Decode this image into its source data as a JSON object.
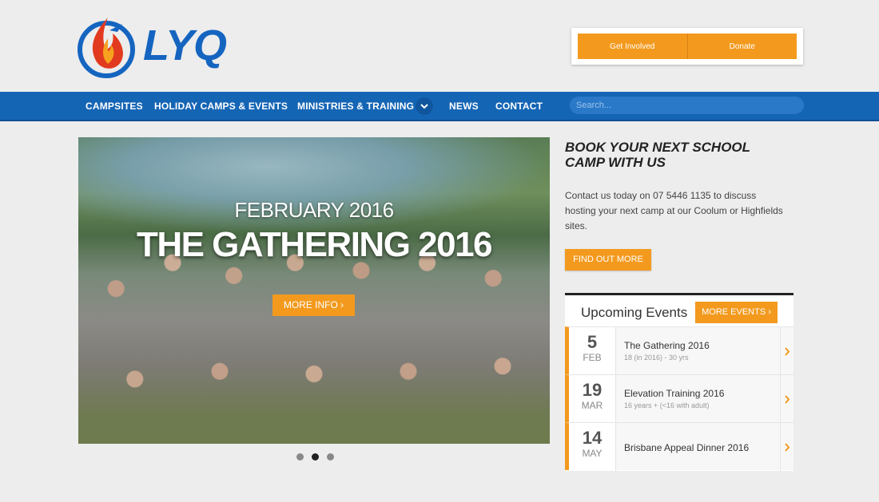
{
  "brand": {
    "name": "LYQ",
    "accent": "#f39a1e",
    "nav_bg": "#1565b5"
  },
  "header": {
    "cta": [
      "Get Involved",
      "Donate"
    ]
  },
  "nav": {
    "items": [
      "CAMPSITES",
      "HOLIDAY CAMPS & EVENTS",
      "MINISTRIES & TRAINING",
      "NEWS",
      "CONTACT"
    ],
    "search_placeholder": "Search..."
  },
  "hero": {
    "date": "FEBRUARY 2016",
    "title": "THE GATHERING 2016",
    "button": "MORE INFO",
    "slides": 3,
    "active_slide": 2
  },
  "sidebar": {
    "book_title": "BOOK YOUR NEXT SCHOOL CAMP WITH US",
    "book_body": "Contact us today on 07 5446 1135 to discuss hosting your next camp at our Coolum or Highfields sites.",
    "find_button": "FIND OUT MORE",
    "events_title": "Upcoming Events",
    "more_events": "MORE EVENTS",
    "events": [
      {
        "day": "5",
        "month": "FEB",
        "name": "The Gathering 2016",
        "sub": "18 (in 2016) - 30 yrs"
      },
      {
        "day": "19",
        "month": "MAR",
        "name": "Elevation Training 2016",
        "sub": "16 years + (<16 with adult)"
      },
      {
        "day": "14",
        "month": "MAY",
        "name": "Brisbane Appeal Dinner 2016",
        "sub": ""
      }
    ]
  }
}
